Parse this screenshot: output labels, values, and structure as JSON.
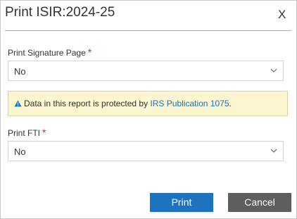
{
  "dialog": {
    "title": "Print ISIR:2024-25",
    "close_label": "X"
  },
  "signature_page": {
    "label": "Print Signature Page",
    "required_marker": "*",
    "value": "No"
  },
  "notice": {
    "icon": "warning-icon",
    "text_before": "Data in this report is protected by ",
    "link_text": "IRS Publication 1075",
    "text_after": "."
  },
  "fti": {
    "label": "Print FTI",
    "required_marker": "*",
    "value": "No"
  },
  "buttons": {
    "print_label": "Print",
    "cancel_label": "Cancel"
  },
  "colors": {
    "primary": "#1e73be",
    "secondary": "#5e5e5e",
    "required": "#d9261c",
    "notice_bg": "#fbf6cf",
    "link": "#1f6fb5"
  }
}
